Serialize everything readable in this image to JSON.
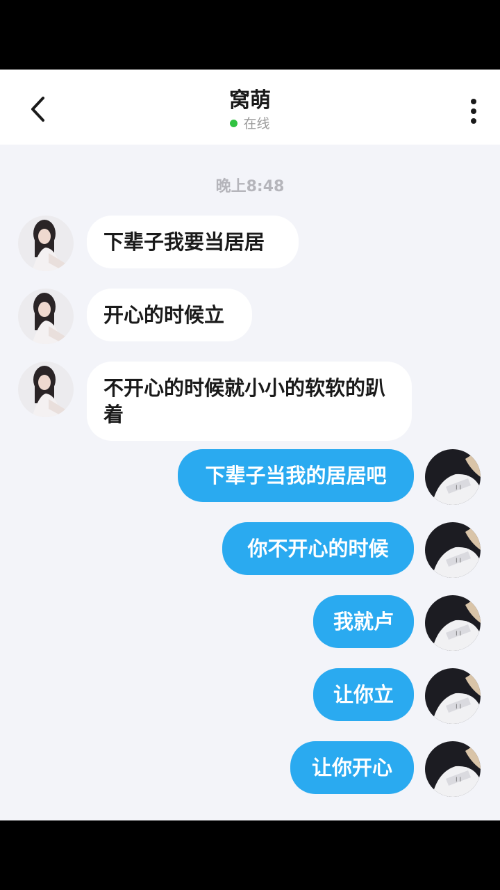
{
  "header": {
    "title": "窝萌",
    "status": "在线",
    "status_color": "#31c241"
  },
  "chat": {
    "timestamp": "晚上8:48",
    "messages": [
      {
        "side": "in",
        "text": "下辈子我要当居居"
      },
      {
        "side": "in",
        "text": "开心的时候立"
      },
      {
        "side": "in",
        "text": "不开心的时候就小小的软软的趴着"
      },
      {
        "side": "out",
        "text": "下辈子当我的居居吧"
      },
      {
        "side": "out",
        "text": "你不开心的时候"
      },
      {
        "side": "out",
        "text": "我就卢"
      },
      {
        "side": "out",
        "text": "让你立"
      },
      {
        "side": "out",
        "text": "让你开心"
      }
    ]
  },
  "colors": {
    "outgoing_bubble": "#2aaaf0",
    "incoming_bubble": "#ffffff",
    "chat_background": "#f3f4f9"
  },
  "icons": [
    "back-arrow-icon",
    "more-vertical-icon"
  ]
}
